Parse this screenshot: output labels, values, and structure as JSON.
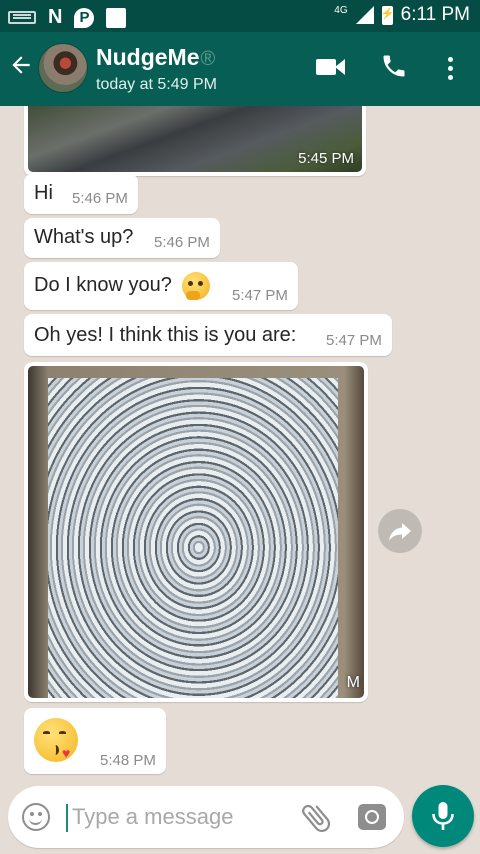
{
  "status_bar": {
    "network": "4G",
    "time": "6:11 PM",
    "notification_icons": [
      "keyboard-icon",
      "n-icon",
      "parking-icon",
      "square-icon"
    ]
  },
  "header": {
    "contact_name": "NudgeMe",
    "name_mark": "®",
    "last_seen": "today at 5:49 PM",
    "icons": [
      "back-arrow-icon",
      "video-call-icon",
      "voice-call-icon",
      "more-options-icon"
    ]
  },
  "messages": [
    {
      "type": "image",
      "time": "5:45 PM"
    },
    {
      "type": "text",
      "text": "Hi",
      "time": "5:46 PM"
    },
    {
      "type": "text",
      "text": "What's up?",
      "time": "5:46 PM"
    },
    {
      "type": "text",
      "text": "Do I know you?",
      "emoji": "thinking-face-icon",
      "time": "5:47 PM"
    },
    {
      "type": "text",
      "text": "Oh yes! I think this is you are:",
      "time": "5:47 PM"
    },
    {
      "type": "image",
      "time_partial": "M",
      "forward_icon": "forward-icon"
    },
    {
      "type": "emoji",
      "emoji": "face-blowing-kiss-icon",
      "time": "5:48 PM"
    }
  ],
  "composer": {
    "placeholder": "Type a message",
    "value": "",
    "icons": [
      "emoji-icon",
      "attach-icon",
      "camera-icon",
      "mic-icon"
    ]
  },
  "colors": {
    "header": "#075e54",
    "status_bar": "#054d44",
    "chat_background": "#e5ddd5",
    "bubble": "#ffffff",
    "accent": "#00897b"
  }
}
